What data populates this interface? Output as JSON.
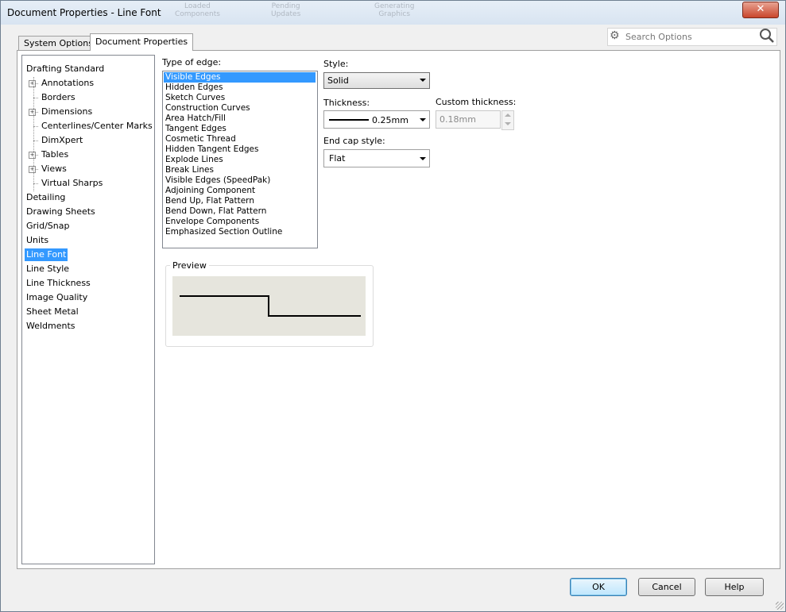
{
  "window": {
    "title": "Document Properties - Line Font",
    "close": "✕",
    "ghost": [
      "Loaded\nComponents",
      "Pending\nUpdates",
      "Generating\nGraphics"
    ]
  },
  "tabs": [
    {
      "label": "System Options"
    },
    {
      "label": "Document Properties"
    }
  ],
  "search": {
    "placeholder": "Search Options"
  },
  "tree": {
    "items": [
      {
        "label": "Drafting Standard",
        "level": 0,
        "expand": false
      },
      {
        "label": "Annotations",
        "level": 1,
        "expand": true
      },
      {
        "label": "Borders",
        "level": 1,
        "expand": false
      },
      {
        "label": "Dimensions",
        "level": 1,
        "expand": true
      },
      {
        "label": "Centerlines/Center Marks",
        "level": 1,
        "expand": false
      },
      {
        "label": "DimXpert",
        "level": 1,
        "expand": false
      },
      {
        "label": "Tables",
        "level": 1,
        "expand": true
      },
      {
        "label": "Views",
        "level": 1,
        "expand": true
      },
      {
        "label": "Virtual Sharps",
        "level": 1,
        "expand": false
      },
      {
        "label": "Detailing",
        "level": 0,
        "expand": false
      },
      {
        "label": "Drawing Sheets",
        "level": 0,
        "expand": false
      },
      {
        "label": "Grid/Snap",
        "level": 0,
        "expand": false
      },
      {
        "label": "Units",
        "level": 0,
        "expand": false
      },
      {
        "label": "Line Font",
        "level": 0,
        "expand": false,
        "selected": true
      },
      {
        "label": "Line Style",
        "level": 0,
        "expand": false
      },
      {
        "label": "Line Thickness",
        "level": 0,
        "expand": false
      },
      {
        "label": "Image Quality",
        "level": 0,
        "expand": false
      },
      {
        "label": "Sheet Metal",
        "level": 0,
        "expand": false
      },
      {
        "label": "Weldments",
        "level": 0,
        "expand": false
      }
    ]
  },
  "edge_type": {
    "label": "Type of edge:",
    "items": [
      "Visible Edges",
      "Hidden Edges",
      "Sketch Curves",
      "Construction Curves",
      "Area Hatch/Fill",
      "Tangent Edges",
      "Cosmetic Thread",
      "Hidden Tangent Edges",
      "Explode Lines",
      "Break Lines",
      "Visible Edges (SpeedPak)",
      "Adjoining Component",
      "Bend Up, Flat Pattern",
      "Bend Down, Flat Pattern",
      "Envelope Components",
      "Emphasized Section Outline"
    ],
    "selected_index": 0
  },
  "style": {
    "label": "Style:",
    "value": "Solid"
  },
  "thickness": {
    "label": "Thickness:",
    "value": "0.25mm"
  },
  "custom_thickness": {
    "label": "Custom thickness:",
    "value": "0.18mm"
  },
  "end_cap": {
    "label": "End cap style:",
    "value": "Flat"
  },
  "preview": {
    "label": "Preview"
  },
  "buttons": {
    "ok": "OK",
    "cancel": "Cancel",
    "help": "Help"
  }
}
